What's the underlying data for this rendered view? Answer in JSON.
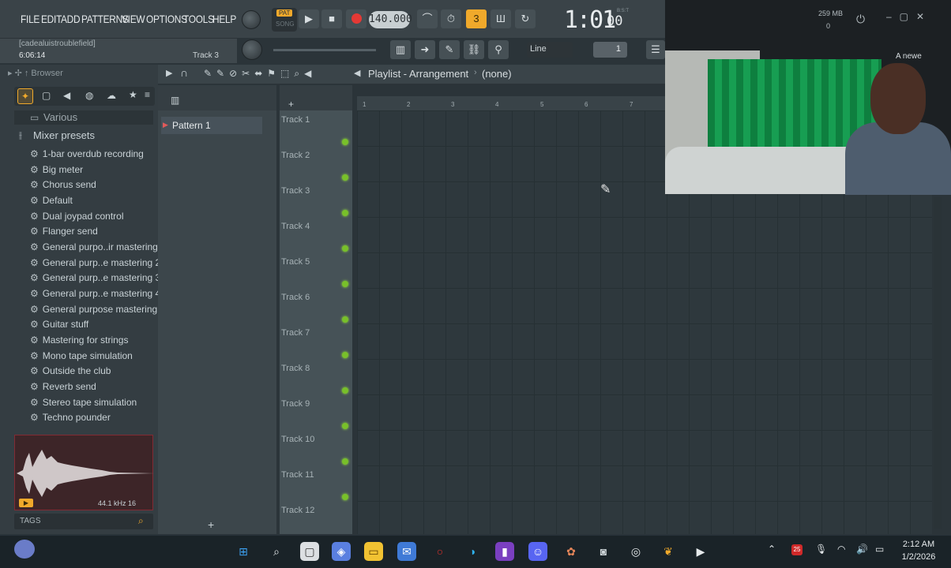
{
  "menu": [
    "FILE",
    "EDIT",
    "ADD",
    "PATTERNS",
    "VIEW",
    "OPTIONS",
    "TOOLS",
    "HELP"
  ],
  "transport": {
    "pat_label": "PAT",
    "song_label": "SONG",
    "tempo": "140.000",
    "time_main": "1:01",
    "time_sub": "00",
    "time_small": "B:S:T"
  },
  "hint": {
    "project": "[cadealuistroublefield]",
    "time": "6:06:14",
    "track": "Track 3"
  },
  "toolbar": {
    "snap": "Line",
    "step": "1"
  },
  "browser": {
    "title": "Browser",
    "folder": "Various",
    "section": "Mixer presets",
    "items": [
      "1-bar overdub recording",
      "Big meter",
      "Chorus send",
      "Default",
      "Dual joypad control",
      "Flanger send",
      "General purpo..ir mastering",
      "General purp..e mastering 2",
      "General purp..e mastering 3",
      "General purp..e mastering 4",
      "General purpose mastering",
      "Guitar stuff",
      "Mastering for strings",
      "Mono tape simulation",
      "Outside the club",
      "Reverb send",
      "Stereo tape simulation",
      "Techno pounder"
    ],
    "sample_info": "44.1 kHz 16",
    "tags": "TAGS"
  },
  "playlist": {
    "title": "Playlist - Arrangement",
    "pattern_sel": "(none)",
    "pattern": "Pattern 1",
    "ruler": [
      "1",
      "2",
      "3",
      "4",
      "5",
      "6",
      "7"
    ],
    "tracks": [
      "Track 1",
      "Track 2",
      "Track 3",
      "Track 4",
      "Track 5",
      "Track 6",
      "Track 7",
      "Track 8",
      "Track 9",
      "Track 10",
      "Track 11",
      "Track 12"
    ]
  },
  "webcam": {
    "stat1": "259 MB",
    "stat2": "0",
    "notice": "A newe"
  },
  "taskbar": {
    "time": "2:12 AM",
    "date": "1/2/2026",
    "badge": "25"
  },
  "colors": {
    "accent": "#f0a92b",
    "track_dot": "#78c02a",
    "record": "#e53935"
  }
}
